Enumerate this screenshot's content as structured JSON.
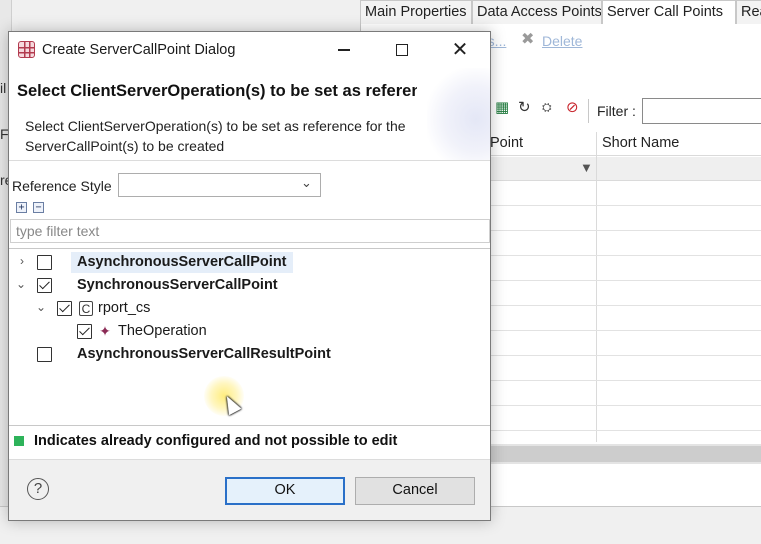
{
  "background": {
    "tabs": [
      "Main Properties",
      "Data Access Points",
      "Server Call Points",
      "Rea"
    ],
    "links": {
      "partial": "nts...",
      "delete": "Delete"
    },
    "filter_label": "Filter :",
    "table_headers": [
      "Point",
      "Short Name"
    ],
    "left_partial": [
      "il",
      "Fo",
      "re"
    ]
  },
  "dialog": {
    "title": "Create ServerCallPoint Dialog",
    "header_title": "Select ClientServerOperation(s) to be set as reference for the ServerCallPoint(s)",
    "header_desc": "Select ClientServerOperation(s) to be set as reference for the ServerCallPoint(s) to be created",
    "reference_style_label": "Reference Style",
    "reference_style_value": "",
    "filter_placeholder": "type filter text",
    "tree": [
      {
        "label": "AsynchronousServerCallPoint",
        "checked": false,
        "expanded": false
      },
      {
        "label": "SynchronousServerCallPoint",
        "checked": true,
        "expanded": true
      },
      {
        "label": "rport_cs",
        "checked": true,
        "expanded": true
      },
      {
        "label": "TheOperation",
        "checked": true
      },
      {
        "label": "AsynchronousServerCallResultPoint",
        "checked": false
      }
    ],
    "legend_text": "Indicates already configured and not possible to edit",
    "legend_color": "#2eb35a",
    "buttons": {
      "ok": "OK",
      "cancel": "Cancel",
      "help": "?"
    }
  }
}
